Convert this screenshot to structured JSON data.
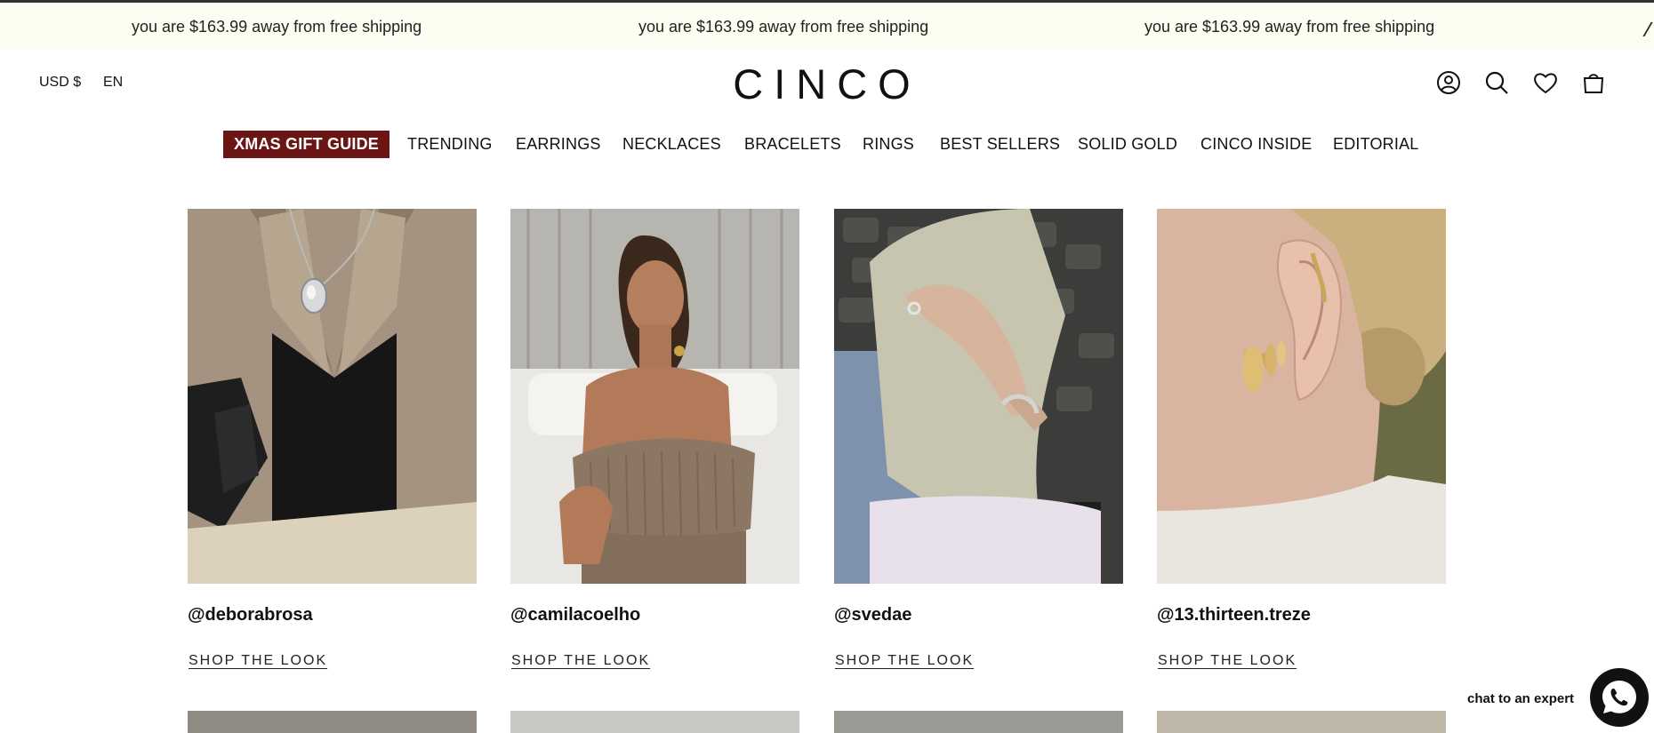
{
  "announcement": {
    "messages": [
      "you are $163.99 away from free shipping",
      "you are $163.99 away from free shipping",
      "you are $163.99 away from free shipping"
    ]
  },
  "header": {
    "currency": "USD $",
    "language": "EN",
    "logo": "CINCO",
    "icons": [
      "account-icon",
      "search-icon",
      "wishlist-heart-icon",
      "shopping-bag-icon"
    ]
  },
  "nav": {
    "items": [
      "XMAS GIFT GUIDE",
      "TRENDING",
      "EARRINGS",
      "NECKLACES",
      "BRACELETS",
      "RINGS",
      "BEST SELLERS",
      "SOLID GOLD",
      "CINCO INSIDE",
      "EDITORIAL"
    ],
    "highlight_color": "#6b1515"
  },
  "looks": [
    {
      "handle": "@deborabrosa",
      "cta": "SHOP THE LOOK"
    },
    {
      "handle": "@camilacoelho",
      "cta": "SHOP THE LOOK"
    },
    {
      "handle": "@svedae",
      "cta": "SHOP THE LOOK"
    },
    {
      "handle": "@13.thirteen.treze",
      "cta": "SHOP THE LOOK"
    }
  ],
  "chat": {
    "label": "chat to an expert",
    "icon": "phone-chat-icon"
  },
  "colors": {
    "announcement_bg": "#fdfdf2",
    "text": "#111111"
  }
}
